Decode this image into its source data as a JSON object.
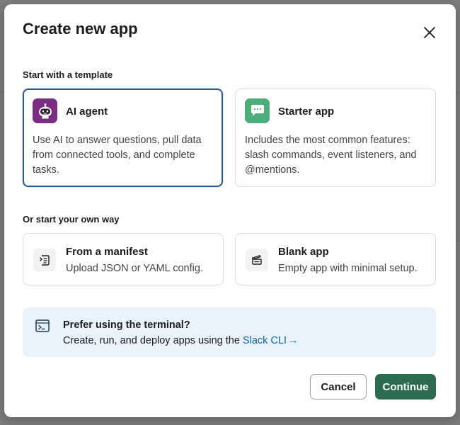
{
  "modal": {
    "title": "Create new app",
    "close_icon": "close-icon"
  },
  "templates": {
    "section_label": "Start with a template",
    "items": [
      {
        "title": "AI agent",
        "description": "Use AI to answer questions, pull data from connected tools, and complete tasks.",
        "icon": "robot-icon",
        "icon_color": "#7b2d82",
        "selected": true
      },
      {
        "title": "Starter app",
        "description": "Includes the most common features: slash commands, event listeners, and @mentions.",
        "icon": "chat-bubble-icon",
        "icon_color": "#4cae7a",
        "selected": false
      }
    ]
  },
  "own_way": {
    "section_label": "Or start your own way",
    "items": [
      {
        "title": "From a manifest",
        "description": "Upload JSON or YAML config.",
        "icon": "manifest-icon"
      },
      {
        "title": "Blank app",
        "description": "Empty app with minimal setup.",
        "icon": "clapperboard-icon"
      }
    ]
  },
  "terminal": {
    "title": "Prefer using the terminal?",
    "description_prefix": "Create, run, and deploy apps using the ",
    "link_label": "Slack CLI",
    "link_arrow": "→",
    "icon": "terminal-icon"
  },
  "buttons": {
    "cancel": "Cancel",
    "continue": "Continue"
  },
  "colors": {
    "selected_border": "#2f5a8f",
    "primary_button": "#2c6b4f",
    "link": "#1264a3",
    "info_background": "#e8f3fb"
  }
}
